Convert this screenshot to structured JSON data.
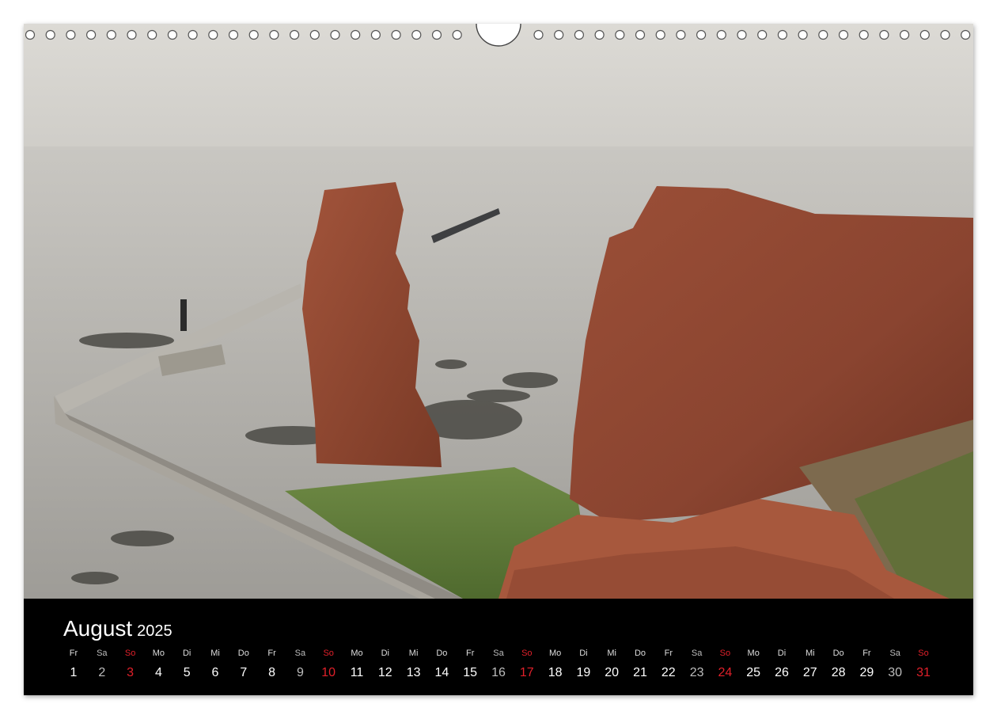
{
  "calendar": {
    "month": "August",
    "year": "2025",
    "days": [
      {
        "wd": "Fr",
        "n": "1",
        "kind": "weekday"
      },
      {
        "wd": "Sa",
        "n": "2",
        "kind": "sat"
      },
      {
        "wd": "So",
        "n": "3",
        "kind": "sun"
      },
      {
        "wd": "Mo",
        "n": "4",
        "kind": "weekday"
      },
      {
        "wd": "Di",
        "n": "5",
        "kind": "weekday"
      },
      {
        "wd": "Mi",
        "n": "6",
        "kind": "weekday"
      },
      {
        "wd": "Do",
        "n": "7",
        "kind": "weekday"
      },
      {
        "wd": "Fr",
        "n": "8",
        "kind": "weekday"
      },
      {
        "wd": "Sa",
        "n": "9",
        "kind": "sat"
      },
      {
        "wd": "So",
        "n": "10",
        "kind": "sun"
      },
      {
        "wd": "Mo",
        "n": "11",
        "kind": "weekday"
      },
      {
        "wd": "Di",
        "n": "12",
        "kind": "weekday"
      },
      {
        "wd": "Mi",
        "n": "13",
        "kind": "weekday"
      },
      {
        "wd": "Do",
        "n": "14",
        "kind": "weekday"
      },
      {
        "wd": "Fr",
        "n": "15",
        "kind": "weekday"
      },
      {
        "wd": "Sa",
        "n": "16",
        "kind": "sat"
      },
      {
        "wd": "So",
        "n": "17",
        "kind": "sun"
      },
      {
        "wd": "Mo",
        "n": "18",
        "kind": "weekday"
      },
      {
        "wd": "Di",
        "n": "19",
        "kind": "weekday"
      },
      {
        "wd": "Mi",
        "n": "20",
        "kind": "weekday"
      },
      {
        "wd": "Do",
        "n": "21",
        "kind": "weekday"
      },
      {
        "wd": "Fr",
        "n": "22",
        "kind": "weekday"
      },
      {
        "wd": "Sa",
        "n": "23",
        "kind": "sat"
      },
      {
        "wd": "So",
        "n": "24",
        "kind": "sun"
      },
      {
        "wd": "Mo",
        "n": "25",
        "kind": "weekday"
      },
      {
        "wd": "Di",
        "n": "26",
        "kind": "weekday"
      },
      {
        "wd": "Mi",
        "n": "27",
        "kind": "weekday"
      },
      {
        "wd": "Do",
        "n": "28",
        "kind": "weekday"
      },
      {
        "wd": "Fr",
        "n": "29",
        "kind": "weekday"
      },
      {
        "wd": "Sa",
        "n": "30",
        "kind": "sat"
      },
      {
        "wd": "So",
        "n": "31",
        "kind": "sun"
      }
    ]
  },
  "colors": {
    "sunday": "#e0202a",
    "saturday": "#bdbdbd",
    "caption_background": "#000000"
  }
}
